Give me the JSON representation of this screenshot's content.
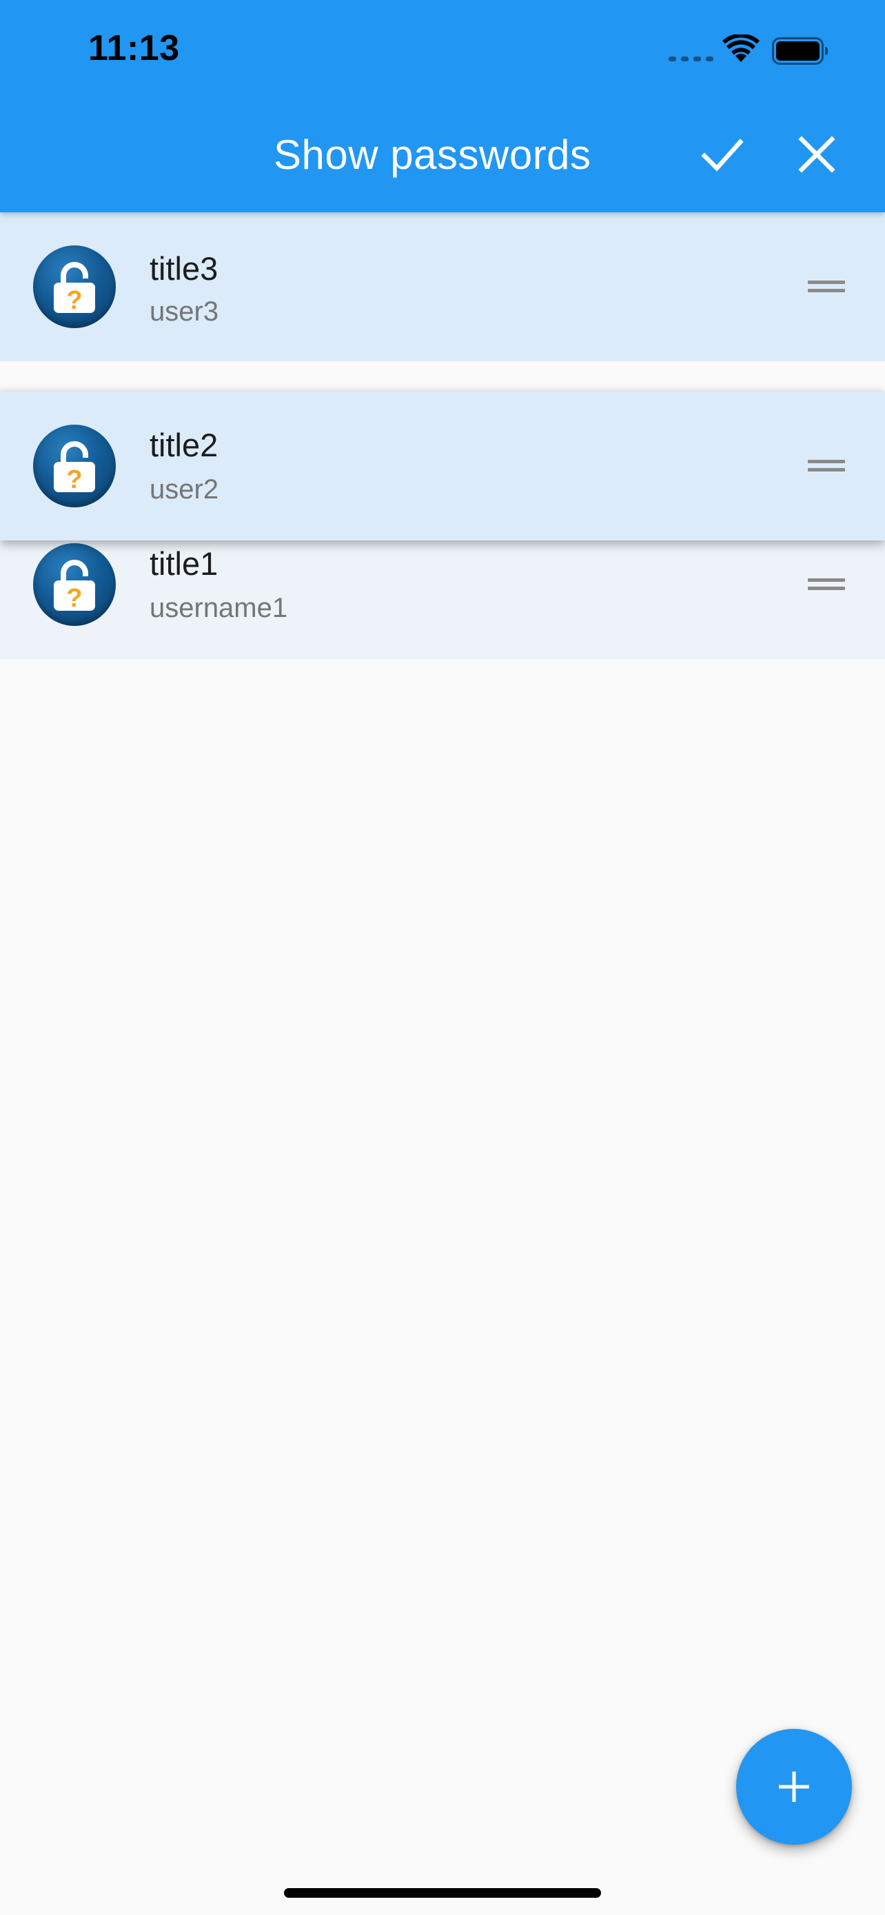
{
  "status_bar": {
    "time": "11:13",
    "icons": [
      "cellular-signal-icon",
      "wifi-icon",
      "battery-icon"
    ]
  },
  "appbar": {
    "title": "Show passwords",
    "actions": [
      {
        "icon": "check-icon",
        "name": "confirm"
      },
      {
        "icon": "close-icon",
        "name": "close"
      }
    ],
    "background_color": "#2196f3"
  },
  "entries": [
    {
      "title": "title3",
      "subtitle": "user3",
      "icon": "padlock-question-icon"
    },
    {
      "title": "title2",
      "subtitle": "user2",
      "icon": "padlock-question-icon"
    },
    {
      "title": "title1",
      "subtitle": "username1",
      "icon": "padlock-question-icon"
    }
  ],
  "fab": {
    "icon": "plus-icon"
  },
  "colors": {
    "accent": "#2196f3",
    "item_background": "#dbebfa",
    "padlock_question": "#f5a623"
  }
}
